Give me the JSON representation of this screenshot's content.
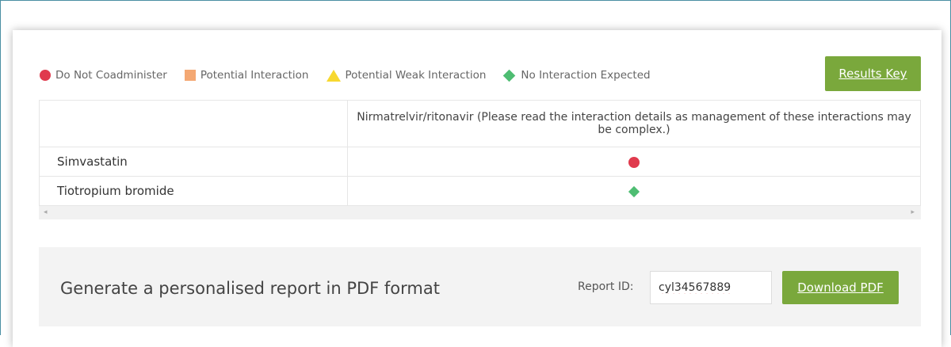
{
  "legend": [
    {
      "label": "Do Not Coadminister",
      "shape": "circle",
      "color": "#e03a4d"
    },
    {
      "label": "Potential Interaction",
      "shape": "square",
      "color": "#f4a873"
    },
    {
      "label": "Potential Weak Interaction",
      "shape": "triangle",
      "color": "#f7d830"
    },
    {
      "label": "No Interaction Expected",
      "shape": "diamond",
      "color": "#4ebd72"
    }
  ],
  "results_key_label": "Results Key",
  "table": {
    "column_header": "Nirmatrelvir/ritonavir (Please read the interaction details as management of these interactions may be complex.)",
    "rows": [
      {
        "drug": "Simvastatin",
        "interaction": "Do Not Coadminister"
      },
      {
        "drug": "Tiotropium bromide",
        "interaction": "No Interaction Expected"
      }
    ],
    "scroll_left": "◂",
    "scroll_right": "▸"
  },
  "report": {
    "title": "Generate a personalised report in PDF format",
    "id_label": "Report ID:",
    "id_value": "cyl34567889",
    "download_label": "Download PDF"
  },
  "colors": {
    "accent_green": "#7aa83c",
    "frame": "#4a8fa3"
  }
}
